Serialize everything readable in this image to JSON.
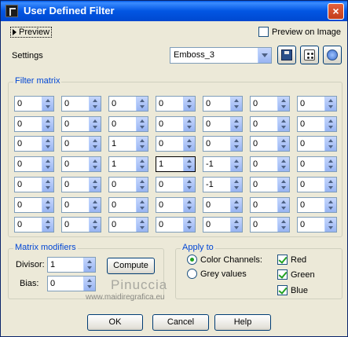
{
  "window": {
    "title": "User Defined Filter",
    "close_glyph": "×"
  },
  "preview": {
    "label": "Preview",
    "preview_on_image_label": "Preview on Image",
    "preview_on_image_checked": false
  },
  "settings": {
    "label": "Settings",
    "preset_value": "Emboss_3"
  },
  "icons": {
    "save": "save-icon",
    "randomize": "randomize-icon",
    "reset": "reset-icon"
  },
  "filter_matrix": {
    "label": "Filter matrix",
    "rows": [
      [
        "0",
        "0",
        "0",
        "0",
        "0",
        "0",
        "0"
      ],
      [
        "0",
        "0",
        "0",
        "0",
        "0",
        "0",
        "0"
      ],
      [
        "0",
        "0",
        "1",
        "0",
        "0",
        "0",
        "0"
      ],
      [
        "0",
        "0",
        "1",
        "1",
        "-1",
        "0",
        "0"
      ],
      [
        "0",
        "0",
        "0",
        "0",
        "-1",
        "0",
        "0"
      ],
      [
        "0",
        "0",
        "0",
        "0",
        "0",
        "0",
        "0"
      ],
      [
        "0",
        "0",
        "0",
        "0",
        "0",
        "0",
        "0"
      ]
    ]
  },
  "matrix_modifiers": {
    "label": "Matrix modifiers",
    "divisor_label": "Divisor:",
    "divisor_value": "1",
    "bias_label": "Bias:",
    "bias_value": "0",
    "compute_label": "Compute"
  },
  "apply_to": {
    "label": "Apply to",
    "color_channels_label": "Color Channels:",
    "grey_values_label": "Grey values",
    "selected": "color_channels",
    "channels": [
      {
        "label": "Red",
        "checked": true
      },
      {
        "label": "Green",
        "checked": true
      },
      {
        "label": "Blue",
        "checked": true
      }
    ]
  },
  "watermark": {
    "name": "Pinuccia",
    "url": "www.maidiregrafica.eu"
  },
  "footer": {
    "ok_label": "OK",
    "cancel_label": "Cancel",
    "help_label": "Help"
  },
  "colors": {
    "title_bar": "#0058e6",
    "group_label": "#0046d5",
    "check": "#21a121",
    "dialog_bg": "#ece9d8"
  }
}
